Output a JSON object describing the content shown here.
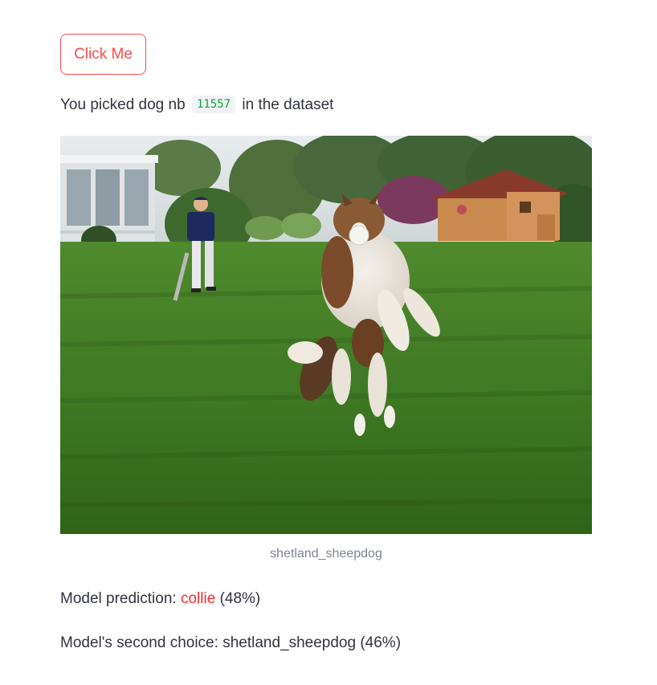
{
  "button": {
    "label": "Click Me"
  },
  "picked": {
    "prefix": "You picked dog nb",
    "index": "11557",
    "suffix": "in the dataset"
  },
  "image": {
    "caption": "shetland_sheepdog",
    "alt": "Dog leaping to catch a ball on a lawn while a child holding a bat stands behind"
  },
  "prediction": {
    "label": "Model prediction:",
    "value": "collie",
    "confidence": "(48%)"
  },
  "second_choice": {
    "label": "Model's second choice:",
    "value": "shetland_sheepdog",
    "confidence": "(46%)"
  },
  "colors": {
    "accent": "#ff4b4b",
    "prediction": "#ff2b2b",
    "code": "#09ab3b",
    "text": "#31333f",
    "caption": "#808495"
  }
}
